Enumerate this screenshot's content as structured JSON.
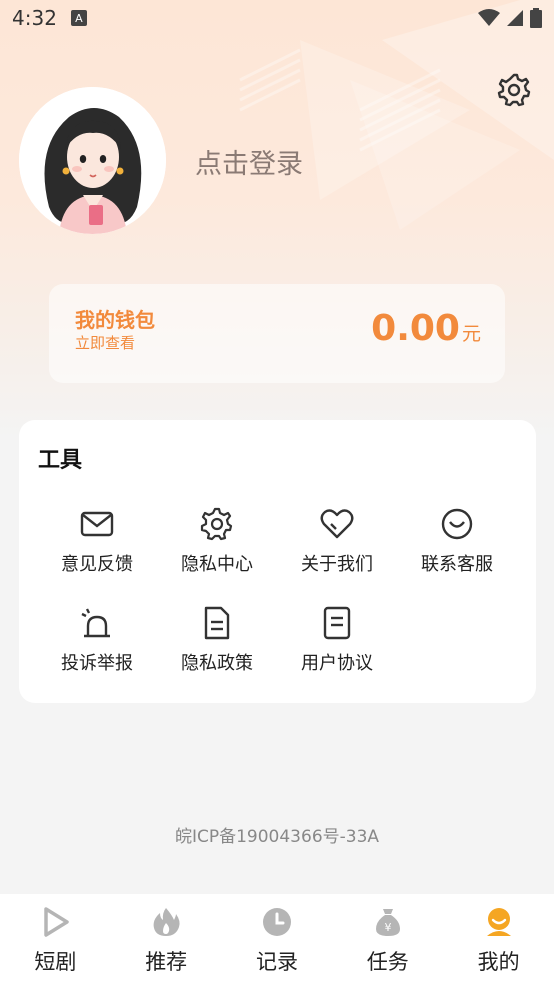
{
  "status_bar": {
    "time": "4:32",
    "notification_glyph": "A",
    "icons": [
      "wifi-icon",
      "signal-icon",
      "battery-icon"
    ]
  },
  "profile": {
    "login_prompt": "点击登录",
    "avatar": "avatar-illustration"
  },
  "wallet": {
    "title": "我的钱包",
    "subtitle": "立即查看",
    "amount": "0.00",
    "unit": "元"
  },
  "tools": {
    "title": "工具",
    "items": [
      {
        "label": "意见反馈",
        "icon": "mail-icon"
      },
      {
        "label": "隐私中心",
        "icon": "gear-icon"
      },
      {
        "label": "关于我们",
        "icon": "heart-icon"
      },
      {
        "label": "联系客服",
        "icon": "smile-icon"
      },
      {
        "label": "投诉举报",
        "icon": "alarm-icon"
      },
      {
        "label": "隐私政策",
        "icon": "document-icon"
      },
      {
        "label": "用户协议",
        "icon": "note-icon"
      }
    ]
  },
  "footer": {
    "icp": "皖ICP备19004366号-33A"
  },
  "tabbar": {
    "items": [
      {
        "label": "短剧",
        "icon": "play-icon"
      },
      {
        "label": "推荐",
        "icon": "flame-icon"
      },
      {
        "label": "记录",
        "icon": "clock-icon"
      },
      {
        "label": "任务",
        "icon": "money-bag-icon"
      },
      {
        "label": "我的",
        "icon": "user-icon"
      }
    ],
    "active_index": 4
  },
  "colors": {
    "accent": "#f28a3c",
    "active_tab": "#f5a623",
    "inactive_icon": "#b5b5b5"
  }
}
